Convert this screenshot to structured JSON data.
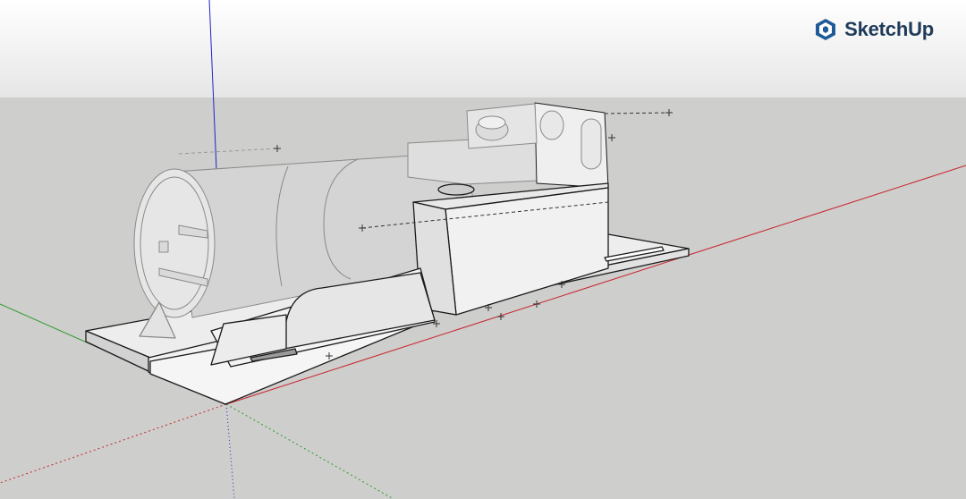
{
  "app": {
    "brand_name": "SketchUp",
    "logo_icon": "sketchup-logo-icon",
    "brand_color": "#1f3b5a"
  },
  "viewport": {
    "sky_color": "#f4f4f4",
    "ground_color": "#cececc",
    "axis_colors": {
      "red": "#c8232c",
      "green": "#2e9a2e",
      "blue": "#2323c8"
    }
  },
  "model": {
    "subject": "locomotive-model"
  }
}
